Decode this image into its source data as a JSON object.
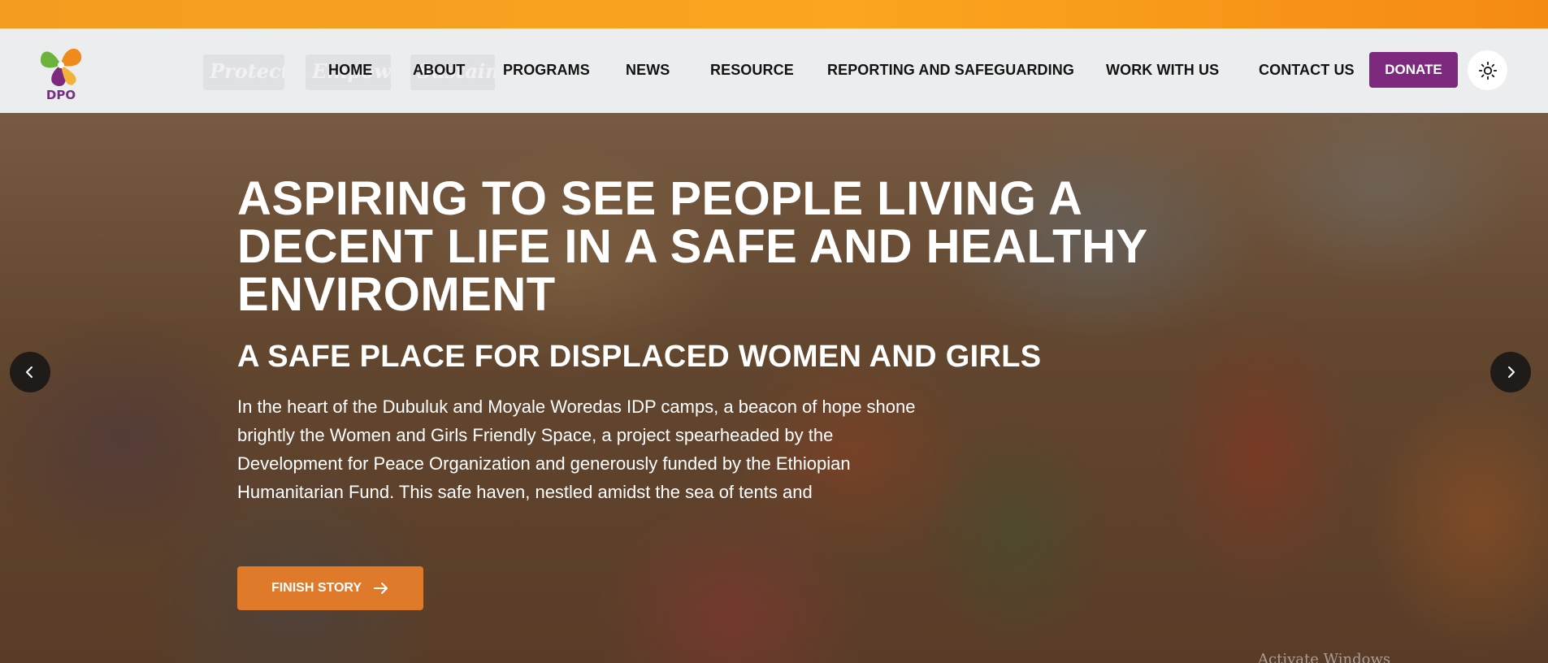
{
  "logo": {
    "text": "DPO"
  },
  "nav": {
    "ghost_items": [
      "Protect",
      "Empower",
      "Sustain"
    ],
    "links": [
      "HOME",
      "ABOUT",
      "PROGRAMS",
      "NEWS",
      "RESOURCE",
      "REPORTING AND SAFEGUARDING",
      "WORK WITH US",
      "CONTACT US"
    ],
    "donate_label": "DONATE",
    "theme_icon": "sun-icon"
  },
  "hero": {
    "title": "ASPIRING TO SEE PEOPLE LIVING A DECENT LIFE IN A SAFE AND HEALTHY ENVIROMENT",
    "subtitle": "A SAFE PLACE FOR DISPLACED WOMEN AND GIRLS",
    "body": "In the heart of the Dubuluk and Moyale Woredas IDP camps, a beacon of hope shone brightly the Women and Girls Friendly Space, a project spearheaded by the Development for Peace Organization and generously funded by the Ethiopian Humanitarian Fund. This safe haven, nestled amidst the sea of tents and",
    "button_label": "FINISH STORY",
    "prev_icon": "chevron-left-icon",
    "next_icon": "chevron-right-icon",
    "corner_text": "Activate Windows"
  },
  "colors": {
    "topbar": "#f7981c",
    "donate": "#7d2a7e",
    "story_button": "#e07a2b",
    "nav_text": "#131313"
  }
}
